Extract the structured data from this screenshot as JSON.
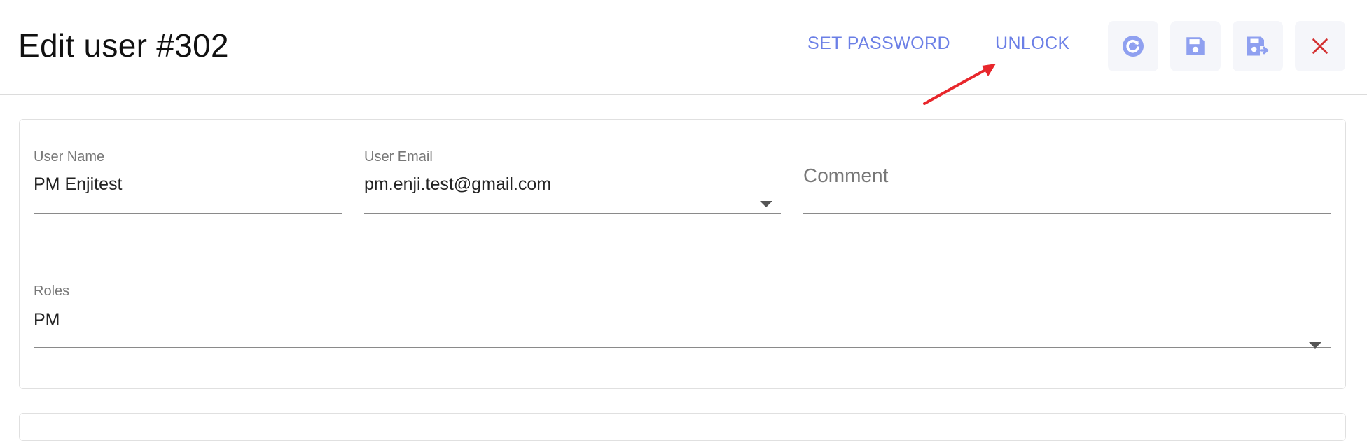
{
  "header": {
    "title": "Edit user #302",
    "actions": {
      "set_password_label": "SET PASSWORD",
      "unlock_label": "UNLOCK"
    },
    "icon_buttons": [
      "refresh-icon",
      "save-icon",
      "save-and-exit-icon",
      "close-icon"
    ]
  },
  "form": {
    "user_name": {
      "label": "User Name",
      "value": "PM Enjitest"
    },
    "user_email": {
      "label": "User Email",
      "value": "pm.enji.test@gmail.com"
    },
    "comment": {
      "placeholder": "Comment",
      "value": ""
    },
    "roles": {
      "label": "Roles",
      "value": "PM"
    }
  },
  "colors": {
    "accent": "#6b7fe6",
    "danger": "#d32f2f",
    "annotation_arrow": "#e8262b"
  }
}
